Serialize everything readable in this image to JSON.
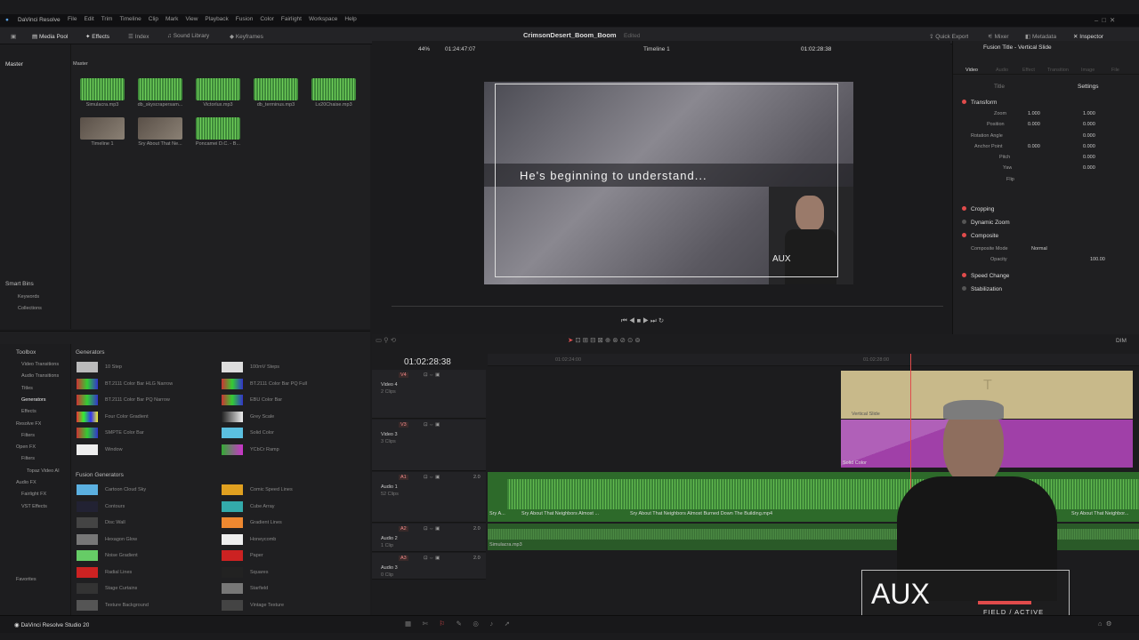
{
  "app": {
    "title": "DaVinci Resolve",
    "menu": [
      "File",
      "Edit",
      "Trim",
      "Timeline",
      "Clip",
      "Mark",
      "View",
      "Playback",
      "Fusion",
      "Color",
      "Fairlight",
      "Workspace",
      "Help"
    ],
    "project_name": "CrimsonDesert_Boom_Boom",
    "project_status": "Edited",
    "quick_export": "Quick Export",
    "mixer": "Mixer",
    "metadata": "Metadata",
    "inspector": "Inspector",
    "brand_footer": "DaVinci Resolve Studio 20"
  },
  "toolbar": {
    "media_pool": "Media Pool",
    "effects": "Effects",
    "index": "Index",
    "sound_library": "Sound Library",
    "keyframes": "Keyframes"
  },
  "media_pool": {
    "bin_master": "Master",
    "header_master": "Master",
    "smart_bins": "Smart Bins",
    "smart_items": [
      "Keywords",
      "Collections"
    ],
    "clips": [
      {
        "label": "Simulacra.mp3",
        "kind": "audio"
      },
      {
        "label": "db_skyscrapersam...",
        "kind": "audio"
      },
      {
        "label": "Victorlux.mp3",
        "kind": "audio"
      },
      {
        "label": "db_terminus.mp3",
        "kind": "audio"
      },
      {
        "label": "Lx20Chaise.mp3",
        "kind": "audio"
      },
      {
        "label": "Timeline 1",
        "kind": "video"
      },
      {
        "label": "Sry About That Ne...",
        "kind": "video"
      },
      {
        "label": "Poncamei D.C. - B...",
        "kind": "audio"
      }
    ]
  },
  "viewer": {
    "zoom": "44%",
    "source_tc": "01:24:47:07",
    "timeline_name": "Timeline 1",
    "record_tc": "01:02:28:38",
    "subtitle": "He's beginning to understand...",
    "aux_label": "AUX"
  },
  "inspector": {
    "title": "Fusion Title - Vertical Slide",
    "tabs": [
      "Video",
      "Audio",
      "Effect",
      "Transition",
      "Image",
      "File"
    ],
    "subtabs": [
      "Title",
      "Settings"
    ],
    "sections": [
      "Transform",
      "Cropping",
      "Dynamic Zoom",
      "Composite",
      "Speed Change",
      "Stabilization"
    ],
    "transform": {
      "zoom_label": "Zoom",
      "zoom_x": "1.000",
      "zoom_y": "1.000",
      "position_label": "Position",
      "pos_x": "0.000",
      "pos_y": "0.000",
      "rotation_label": "Rotation Angle",
      "rotation": "0.000",
      "anchor_label": "Anchor Point",
      "anchor_x": "0.000",
      "anchor_y": "0.000",
      "pitch_label": "Pitch",
      "pitch": "0.000",
      "yaw_label": "Yaw",
      "yaw": "0.000",
      "flip_label": "Flip"
    },
    "composite": {
      "mode_label": "Composite Mode",
      "mode": "Normal",
      "opacity_label": "Opacity",
      "opacity": "100.00"
    }
  },
  "effects": {
    "toolbox": "Toolbox",
    "tree": [
      "Video Transitions",
      "Audio Transitions",
      "Titles",
      "Generators",
      "Effects",
      "Resolve FX",
      "Filters",
      "Open FX",
      "Filters",
      "Topaz Video AI",
      "Audio FX",
      "Fairlight FX",
      "VST Effects",
      "Favorites"
    ],
    "generators_header": "Generators",
    "generators": [
      "10 Step",
      "100mV Steps",
      "BT.2111 Color Bar HLG Narrow",
      "BT.2111 Color Bar PQ Full",
      "BT.2111 Color Bar PQ Narrow",
      "EBU Color Bar",
      "Four Color Gradient",
      "Grey Scale",
      "SMPTE Color Bar",
      "Solid Color",
      "Window",
      "YCbCr Ramp"
    ],
    "fusion_header": "Fusion Generators",
    "fusion_generators": [
      "Cartoon Cloud Sky",
      "Comic Speed Lines",
      "Contours",
      "Cube Array",
      "Disc Wall",
      "Gradient Lines",
      "Hexagon Glow",
      "Honeycomb",
      "Noise Gradient",
      "Paper",
      "Radial Lines",
      "Squares",
      "Stage Curtains",
      "Starfield",
      "Texture Background",
      "Vintage Texture"
    ]
  },
  "timeline": {
    "timecode": "01:02:28:38",
    "ruler_marks": [
      "01:02:24:00",
      "01:02:28:00"
    ],
    "tracks": [
      {
        "id": "V4",
        "name": "Video 4",
        "clips": "2 Clips"
      },
      {
        "id": "V3",
        "name": "Video 3",
        "clips": "3 Clips"
      },
      {
        "id": "A1",
        "name": "Audio 1",
        "clips": "52 Clips",
        "level": "2.0"
      },
      {
        "id": "A2",
        "name": "Audio 2",
        "clips": "1 Clip",
        "level": "2.0"
      },
      {
        "id": "A3",
        "name": "Audio 3",
        "clips": "0 Clip",
        "level": "2.0"
      }
    ],
    "title_clip": "Vertical Slide",
    "solid_clip": "Solid Color",
    "audio_clip_short": "Sry A...",
    "audio_clip_mid": "Sry About That Neighbors Almost ...",
    "audio_clip_main": "Sry About That Neighbors Almost Burned Down The Building.mp4",
    "audio_clip_right": "Sry About That Neighbor...",
    "audio2_clip": "Simulacra.mp3",
    "volume_label": "DIM"
  },
  "overlay": {
    "aux": "AUX",
    "status": "FIELD / ACTIVE"
  },
  "colors": {
    "accent_red": "#e04b4b",
    "audio_green": "#3f8a3a",
    "title_tan": "#c8b98a",
    "solid_purple": "#a040a8"
  }
}
